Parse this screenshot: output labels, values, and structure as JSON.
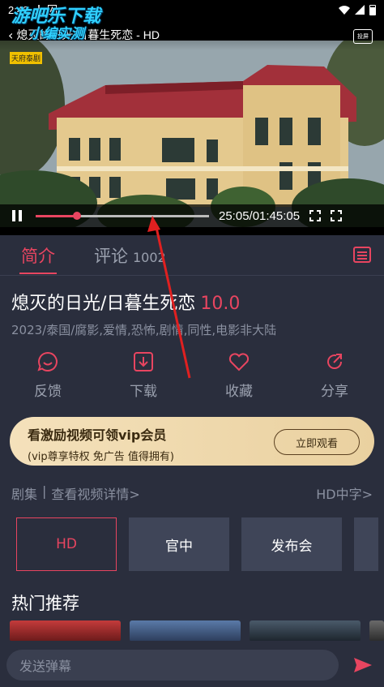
{
  "status": {
    "time": "2:48",
    "icons": [
      "download-icon",
      "font-icon",
      "wifi-icon",
      "signal-icon",
      "battery-icon"
    ]
  },
  "watermark": {
    "line1": "游吧乐下载",
    "line2": "小编实测"
  },
  "player": {
    "back_glyph": "‹",
    "title": "熄灭的日光/日暮生死恋 - HD",
    "cast_label": "投屏",
    "channel_logo": "天府泰剧",
    "progress_fraction": 0.24,
    "time_display": "25:05/01:45:05"
  },
  "tabs": {
    "intro": "简介",
    "comments": "评论",
    "comment_count": "1002"
  },
  "movie": {
    "title": "熄灭的日光/日暮生死恋",
    "score": "10.0",
    "meta": "2023/泰国/腐影,爱情,恐怖,剧情,同性,电影非大陆"
  },
  "actions": [
    {
      "name": "feedback",
      "label": "反馈",
      "icon": "feedback-icon"
    },
    {
      "name": "download",
      "label": "下载",
      "icon": "download-icon"
    },
    {
      "name": "favorite",
      "label": "收藏",
      "icon": "heart-icon"
    },
    {
      "name": "share",
      "label": "分享",
      "icon": "share-icon"
    }
  ],
  "vip": {
    "title": "看激励视频可领vip会员",
    "subtitle": "(vip尊享特权 免广告 值得拥有)",
    "button": "立即观看"
  },
  "episodes": {
    "label": "剧集",
    "sep": "|",
    "details": "查看视频详情>",
    "quality": "HD中字>",
    "items": [
      "HD",
      "官中",
      "发布会"
    ]
  },
  "hot": {
    "title": "热门推荐"
  },
  "bottom": {
    "danmu_placeholder": "发送弹幕"
  },
  "colors": {
    "accent": "#e84560",
    "background": "#2a2e3d",
    "vip_gold": "#f4e1bb"
  }
}
